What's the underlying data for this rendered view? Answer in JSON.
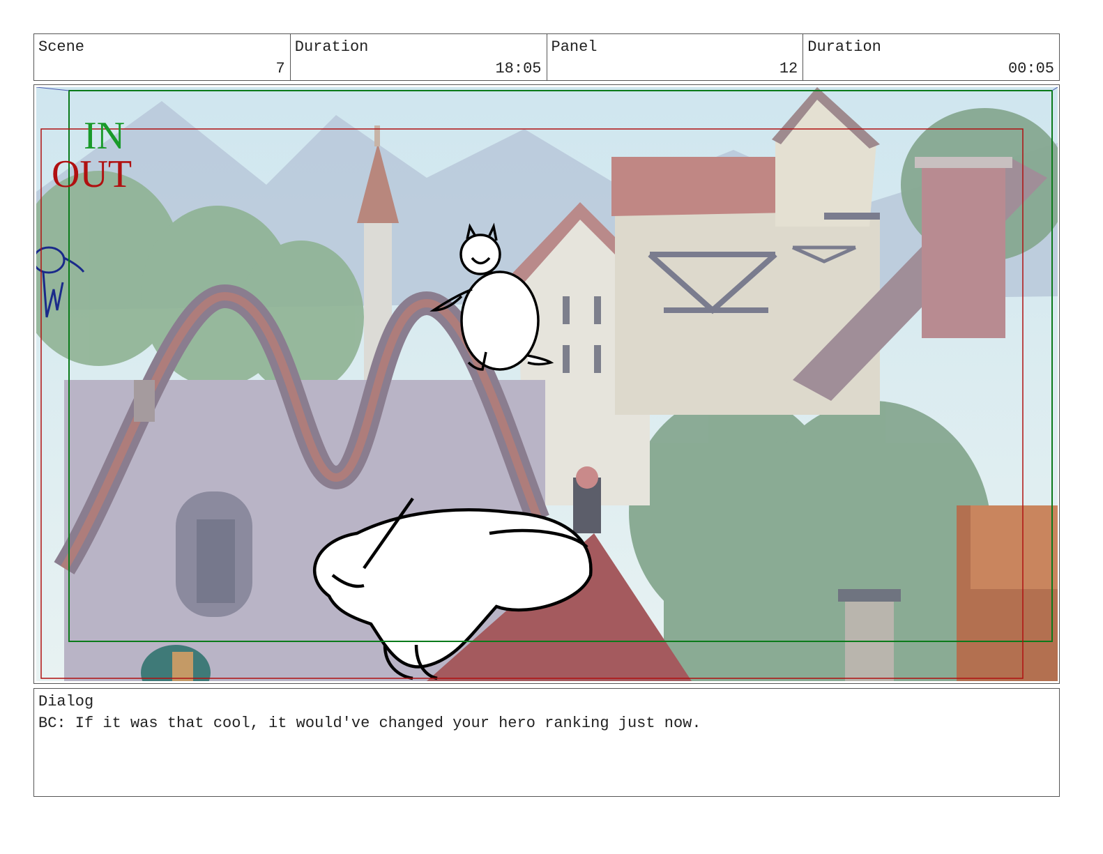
{
  "header": {
    "scene_label": "Scene",
    "scene_value": "7",
    "scene_duration_label": "Duration",
    "scene_duration_value": "18:05",
    "panel_label": "Panel",
    "panel_value": "12",
    "panel_duration_label": "Duration",
    "panel_duration_value": "00:05"
  },
  "frame": {
    "in_label": "IN",
    "out_label": "OUT",
    "in_color": "#1a9a2a",
    "out_color": "#b01010"
  },
  "dialog": {
    "label": "Dialog",
    "text": "BC: If it was that cool, it would've changed your hero ranking just now."
  }
}
